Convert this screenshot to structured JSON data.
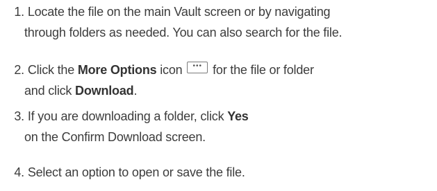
{
  "steps": [
    {
      "number": "1.",
      "line1": "Locate the file on the main Vault screen or by navigating",
      "line2": "through folders as needed. You can also search for the file."
    },
    {
      "number": "2.",
      "prefix": "Click the ",
      "bold1": "More Options",
      "mid": " icon ",
      "icon": "more-options-icon",
      "suffix": " for the file or folder",
      "line2_prefix": "and click ",
      "bold2": "Download",
      "line2_suffix": "."
    },
    {
      "number": "3.",
      "prefix": "If you are downloading a folder, click ",
      "bold1": "Yes",
      "line2": "on the Confirm Download screen."
    },
    {
      "number": "4.",
      "line1": "Select an option to open or save the file."
    }
  ]
}
